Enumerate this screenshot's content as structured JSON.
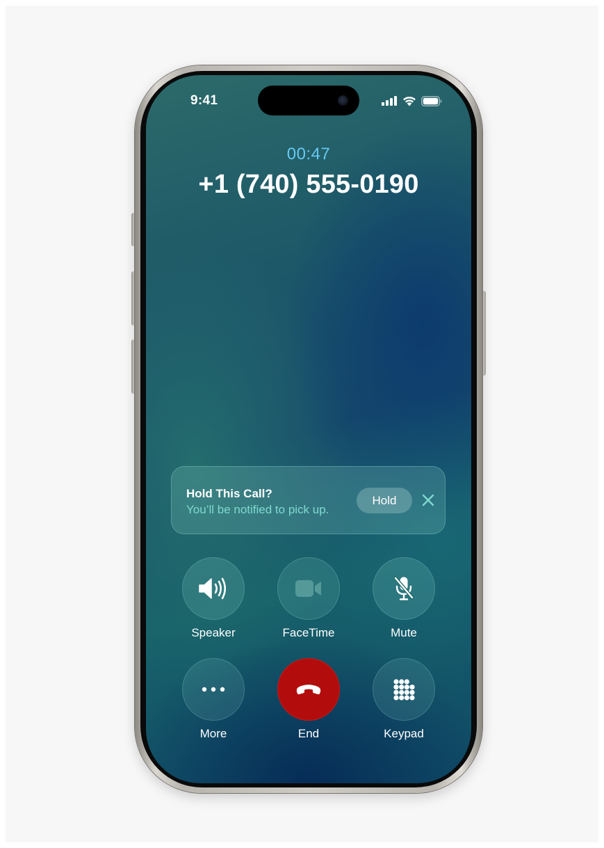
{
  "status_bar": {
    "time": "9:41"
  },
  "call": {
    "timer": "00:47",
    "number": "+1 (740) 555-0190"
  },
  "hold_banner": {
    "title": "Hold This Call?",
    "subtitle": "You’ll be notified to pick up.",
    "hold_label": "Hold"
  },
  "controls": {
    "speaker": "Speaker",
    "facetime": "FaceTime",
    "mute": "Mute",
    "more": "More",
    "end": "End",
    "keypad": "Keypad"
  },
  "icons": {
    "status": [
      "cellular-signal-icon",
      "wifi-icon",
      "battery-icon"
    ],
    "speaker": "speaker-icon",
    "facetime": "video-camera-icon",
    "mute": "microphone-slash-icon",
    "more": "ellipsis-icon",
    "end": "phone-hangup-icon",
    "keypad": "keypad-icon",
    "close": "close-icon"
  },
  "colors": {
    "timer": "#67c8f2",
    "hold_subtitle": "#7fd9cf",
    "end_button": "#b30c0c"
  }
}
